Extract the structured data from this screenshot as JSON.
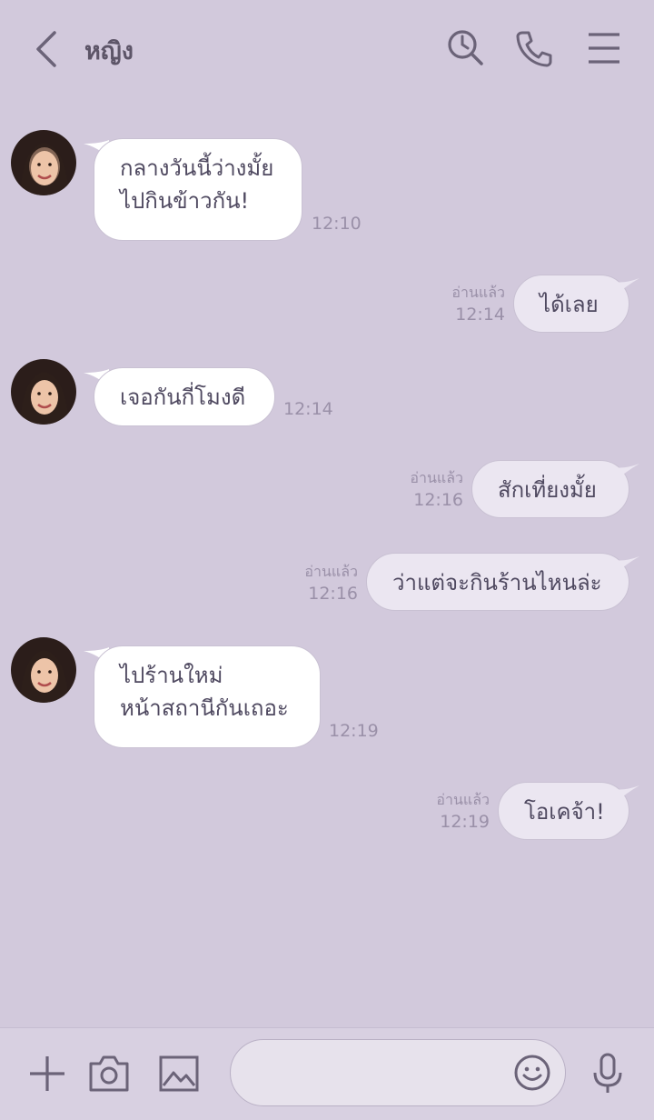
{
  "header": {
    "back_icon": "chevron-left-icon",
    "title": "หญิง",
    "icons": [
      "search-history-icon",
      "phone-icon",
      "menu-icon"
    ]
  },
  "messages": [
    {
      "side": "in",
      "lines": [
        "กลางวันนี้ว่างมั้ย",
        "ไปกินข้าวกัน!"
      ],
      "time": "12:10"
    },
    {
      "side": "out",
      "lines": [
        "ได้เลย"
      ],
      "read": "อ่านแล้ว",
      "time": "12:14"
    },
    {
      "side": "in",
      "lines": [
        "เจอกันกี่โมงดี"
      ],
      "time": "12:14"
    },
    {
      "side": "out",
      "lines": [
        "สักเที่ยงมั้ย"
      ],
      "read": "อ่านแล้ว",
      "time": "12:16"
    },
    {
      "side": "out",
      "lines": [
        "ว่าแต่จะกินร้านไหนล่ะ"
      ],
      "read": "อ่านแล้ว",
      "time": "12:16"
    },
    {
      "side": "in",
      "lines": [
        "ไปร้านใหม่",
        "หน้าสถานีกันเถอะ"
      ],
      "time": "12:19"
    },
    {
      "side": "out",
      "lines": [
        "โอเคจ้า!"
      ],
      "read": "อ่านแล้ว",
      "time": "12:19"
    }
  ],
  "composer": {
    "placeholder": "",
    "icons": [
      "plus-icon",
      "camera-icon",
      "image-icon",
      "emoji-icon",
      "microphone-icon"
    ]
  },
  "colors": {
    "background": "#d2c9dc",
    "icon": "#6b6378",
    "bubble_in": "#ffffff",
    "bubble_out": "#ebe6f1"
  }
}
